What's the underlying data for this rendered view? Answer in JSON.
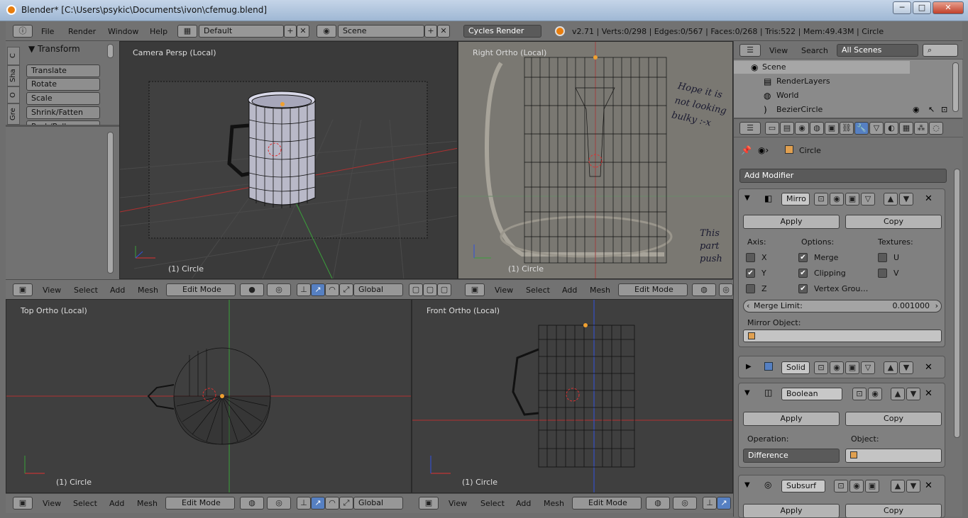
{
  "window": {
    "title": "Blender* [C:\\Users\\psykic\\Documents\\ivon\\cfemug.blend]",
    "min": "─",
    "max": "□",
    "close": "✕"
  },
  "topbar": {
    "menus": [
      "File",
      "Render",
      "Window",
      "Help"
    ],
    "layout": "Default",
    "scene": "Scene",
    "engine": "Cycles Render",
    "stats": "v2.71 | Verts:0/298 | Edges:0/567 | Faces:0/268 | Tris:522 | Mem:49.43M | Circle"
  },
  "tool_shelf": {
    "header": "▼ Transform",
    "buttons": [
      "Translate",
      "Rotate",
      "Scale",
      "Shrink/Fatten",
      "Push/Pull"
    ],
    "tabs": [
      "C",
      "Sha",
      "O",
      "Gre"
    ]
  },
  "viewports": {
    "camera": {
      "name": "Camera Persp (Local)",
      "object": "(1) Circle"
    },
    "right": {
      "name": "Right Ortho (Local)",
      "object": "(1) Circle",
      "notes": [
        "Hope it is",
        "not looking",
        "bulky :-x",
        "This",
        "part",
        "push"
      ]
    },
    "top": {
      "name": "Top Ortho (Local)",
      "object": "(1) Circle"
    },
    "front": {
      "name": "Front Ortho (Local)",
      "object": "(1) Circle"
    }
  },
  "view_header": {
    "menus": [
      "View",
      "Select",
      "Add",
      "Mesh"
    ],
    "mode": "Edit Mode",
    "orientation": "Global"
  },
  "outliner": {
    "menus": [
      "View",
      "Search"
    ],
    "filter": "All Scenes",
    "items": [
      "Scene",
      "RenderLayers",
      "World",
      "BezierCircle"
    ]
  },
  "properties": {
    "object": "Circle",
    "add_modifier": "Add Modifier",
    "mirror": {
      "name": "Mirro",
      "apply": "Apply",
      "copy": "Copy",
      "axis_label": "Axis:",
      "options_label": "Options:",
      "textures_label": "Textures:",
      "axes": [
        {
          "label": "X",
          "checked": false
        },
        {
          "label": "Y",
          "checked": true
        },
        {
          "label": "Z",
          "checked": false
        }
      ],
      "options": [
        {
          "label": "Merge",
          "checked": true
        },
        {
          "label": "Clipping",
          "checked": true
        },
        {
          "label": "Vertex Grou…",
          "checked": true
        }
      ],
      "textures": [
        {
          "label": "U",
          "checked": false
        },
        {
          "label": "V",
          "checked": false
        }
      ],
      "merge_limit_label": "Merge Limit:",
      "merge_limit_value": "0.001000",
      "mirror_object_label": "Mirror Object:"
    },
    "solid": {
      "name": "Solid"
    },
    "boolean": {
      "name": "Boolean",
      "apply": "Apply",
      "copy": "Copy",
      "operation_label": "Operation:",
      "object_label": "Object:",
      "operation": "Difference"
    },
    "subsurf": {
      "name": "Subsurf",
      "apply": "Apply",
      "copy": "Copy"
    }
  },
  "colors": {
    "accent": "#5680c2",
    "viewport_bg": "#3c3c3c",
    "panel": "#727272"
  }
}
